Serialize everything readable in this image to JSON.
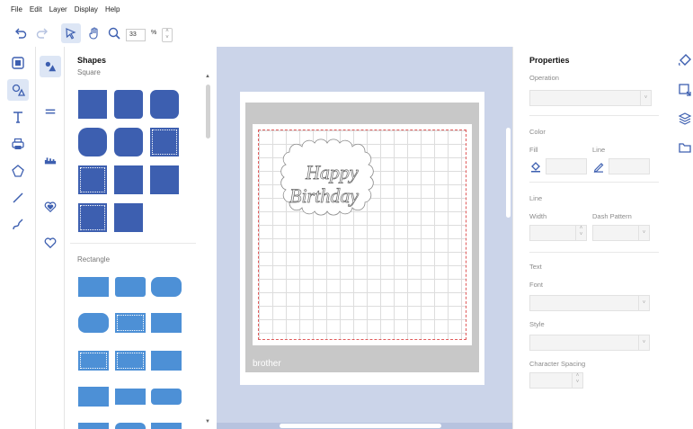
{
  "menu": [
    "File",
    "Edit",
    "Layer",
    "Display",
    "Help"
  ],
  "toolbar": {
    "zoom_value": "33",
    "zoom_unit": "%"
  },
  "shapes_panel": {
    "title": "Shapes",
    "section_square": "Square",
    "section_rectangle": "Rectangle"
  },
  "canvas": {
    "brand": "brother",
    "design_text_line1": "Happy",
    "design_text_line2": "Birthday"
  },
  "properties": {
    "title": "Properties",
    "operation_label": "Operation",
    "color_label": "Color",
    "fill_label": "Fill",
    "line_label": "Line",
    "line_section_label": "Line",
    "width_label": "Width",
    "dash_label": "Dash Pattern",
    "text_section_label": "Text",
    "font_label": "Font",
    "style_label": "Style",
    "char_spacing_label": "Character Spacing"
  },
  "colors": {
    "accent": "#dde6f5",
    "square_shape": "#3d5fb0",
    "rect_shape": "#4d90d6",
    "canvas_bg": "#cbd4e9",
    "mat_gray": "#c8c8c8",
    "grid_border": "#e05a5a"
  }
}
